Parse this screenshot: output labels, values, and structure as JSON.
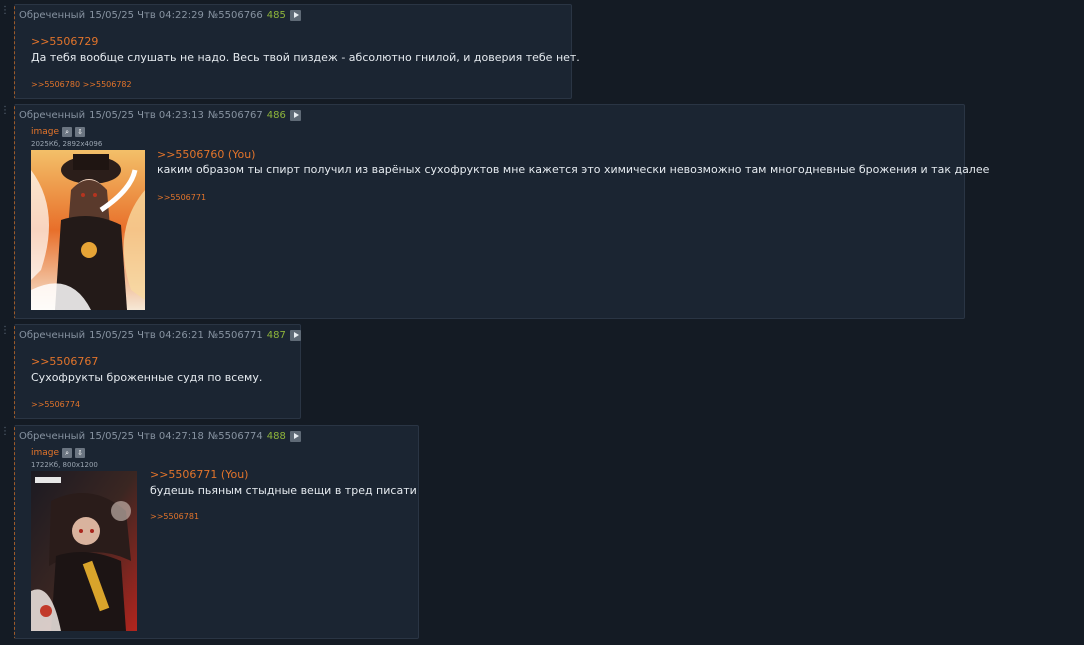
{
  "posts": [
    {
      "author": "Обреченный",
      "date": "15/05/25 Чтв 04:22:29",
      "id": "№5506766",
      "number": "485",
      "reply_to": ">>5506729",
      "text": "Да тебя вообще слушать не надо. Весь твой пиздеж - абсолютно гнилой, и доверия тебе нет.",
      "backrefs": ">>5506780 >>5506782"
    },
    {
      "author": "Обреченный",
      "date": "15/05/25 Чтв 04:23:13",
      "id": "№5506767",
      "number": "486",
      "file_label": "image",
      "file_meta": "2025Кб, 2892x4096",
      "reply_to": ">>5506760 (You)",
      "text": "каким образом ты спирт получил из варёных сухофруктов мне кажется это химически невозможно там многодневные брожения и так далее",
      "backrefs": ">>5506771"
    },
    {
      "author": "Обреченный",
      "date": "15/05/25 Чтв 04:26:21",
      "id": "№5506771",
      "number": "487",
      "reply_to": ">>5506767",
      "text": "Сухофрукты броженные судя по всему.",
      "backrefs": ">>5506774"
    },
    {
      "author": "Обреченный",
      "date": "15/05/25 Чтв 04:27:18",
      "id": "№5506774",
      "number": "488",
      "file_label": "image",
      "file_meta": "1722Кб, 800x1200",
      "reply_to": ">>5506771 (You)",
      "text": "будешь пьяным стыдные вещи в тред писати",
      "backrefs": ">>5506781"
    }
  ],
  "icons": {
    "play": "play-icon",
    "search": "magnify-icon",
    "download": "download-icon"
  },
  "colors": {
    "accent": "#e2742b",
    "number": "#8fb53b",
    "post_bg": "#1b2532",
    "page_bg": "#141b24"
  }
}
